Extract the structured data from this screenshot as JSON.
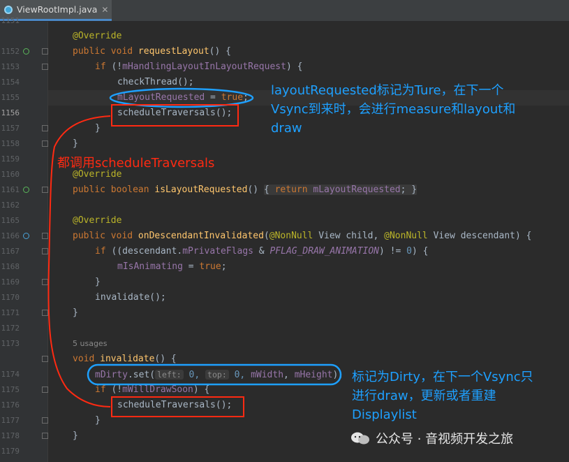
{
  "tab": {
    "title": "ViewRootImpl.java",
    "icon": "java-class-icon"
  },
  "line_numbers": [
    "1151",
    "1152",
    "1153",
    "1154",
    "1155",
    "1156",
    "1157",
    "1158",
    "1159",
    "1160",
    "1161",
    "1162",
    "1165",
    "1166",
    "1167",
    "1168",
    "1169",
    "1170",
    "1171",
    "1172",
    "1173",
    "",
    "1174",
    "1175",
    "1176",
    "1177",
    "1178",
    "1179"
  ],
  "code": {
    "usages": "5 usages",
    "ann1": "@Override",
    "l1153_a": "public void ",
    "l1153_fn": "requestLayout",
    "l1153_b": "() {",
    "l1154_a": "if",
    "l1154_b": " (!",
    "l1154_fld": "mHandlingLayoutInLayoutRequest",
    "l1154_c": ") {",
    "l1155": "checkThread();",
    "l1156_fld": "mLayoutRequested",
    "l1156_a": " = ",
    "l1156_kw": "true",
    "l1156_b": ";",
    "l1157": "scheduleTraversals();",
    "brace": "}",
    "l1162_a": "public boolean ",
    "l1162_fn": "isLayoutRequested",
    "l1162_b": "() ",
    "l1162_c": "{ ",
    "l1162_kw": "return ",
    "l1162_fld": "mLayoutRequested",
    "l1162_d": "; }",
    "ann2": "@Override",
    "ann3": "@Override",
    "l1167_a": "public void ",
    "l1167_fn": "onDescendantInvalidated",
    "l1167_b": "(",
    "l1167_an1": "@NonNull",
    "l1167_c": " View child, ",
    "l1167_an2": "@NonNull",
    "l1167_d": " View descendant) {",
    "l1168_kw": "if",
    "l1168_a": " ((descendant.",
    "l1168_fld": "mPrivateFlags",
    "l1168_b": " & ",
    "l1168_cst": "PFLAG_DRAW_ANIMATION",
    "l1168_c": ") != ",
    "l1168_num": "0",
    "l1168_d": ") {",
    "l1169_fld": "mIsAnimating",
    "l1169_a": " = ",
    "l1169_kw": "true",
    "l1169_b": ";",
    "l1171": "invalidate();",
    "l1174_kw": "void ",
    "l1174_fn": "invalidate",
    "l1174_b": "() {",
    "l1175_fld": "mDirty",
    "l1175_a": ".set(",
    "l1175_h1": "left:",
    "l1175_v1": " 0, ",
    "l1175_h2": "top:",
    "l1175_v2": " 0, ",
    "l1175_fld2": "mWidth",
    "l1175_c": ", ",
    "l1175_fld3": "mHeight",
    "l1175_d": ");",
    "l1176_kw": "if",
    "l1176_a": " (!",
    "l1176_fld": "mWillDrawSoon",
    "l1176_b": ") {",
    "l1177": "scheduleTraversals();"
  },
  "annotations": {
    "top_right": [
      "layoutRequested标记为Ture，在下一个",
      "Vsync到来时，会进行measure和layout和",
      "draw"
    ],
    "left_red": "都调用scheduleTraversals",
    "bottom_right": [
      "标记为Dirty，在下一个Vsync只",
      "进行draw，更新或者重建",
      "Displaylist"
    ]
  },
  "watermark": "公众号 · 音视频开发之旅",
  "colors": {
    "blue_annotation": "#1ea0ff",
    "red_annotation": "#ff2a12",
    "tab_accent": "#4a88c7"
  }
}
